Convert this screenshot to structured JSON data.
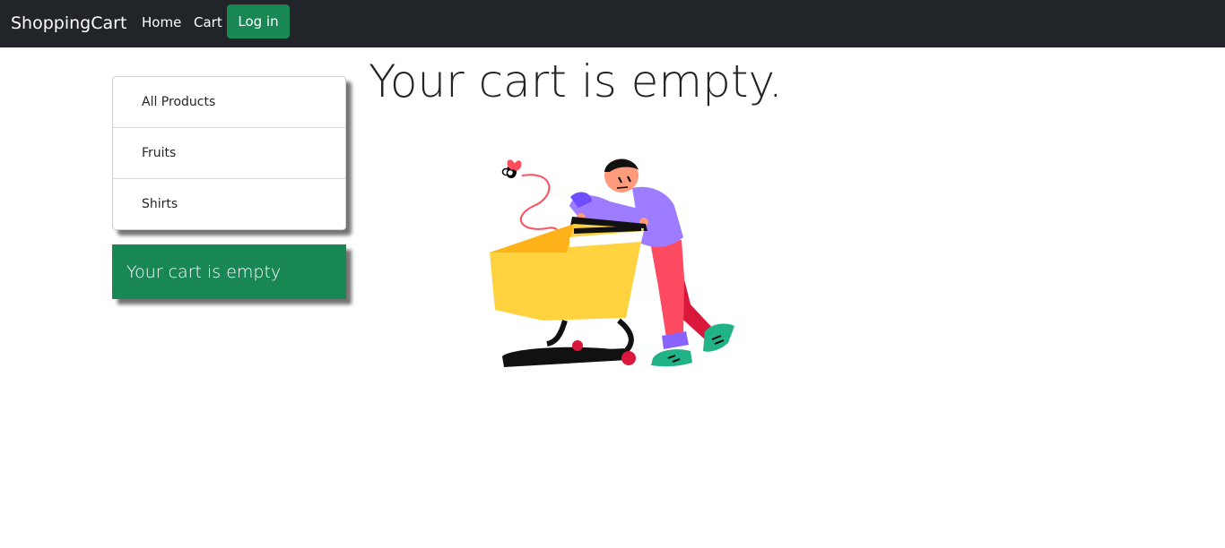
{
  "navbar": {
    "brand": "ShoppingCart",
    "links": [
      {
        "label": "Home"
      },
      {
        "label": "Cart"
      }
    ],
    "login_label": "Log in",
    "colors": {
      "background": "#212529",
      "login": "#198754"
    }
  },
  "sidebar": {
    "categories": [
      {
        "label": "All Products"
      },
      {
        "label": "Fruits"
      },
      {
        "label": "Shirts"
      }
    ],
    "cart_status": "Your cart is empty"
  },
  "main": {
    "heading": "Your cart is empty.",
    "illustration": "person-pushing-empty-shopping-cart-with-fly"
  }
}
